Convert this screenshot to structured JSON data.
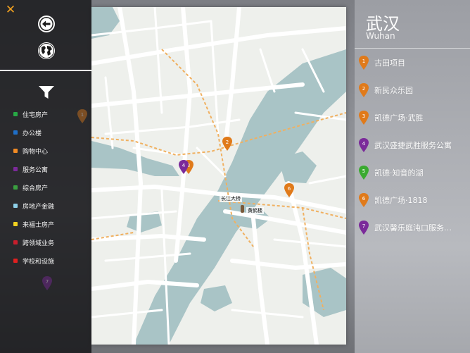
{
  "left_panel": {
    "categories": [
      {
        "label": "住宅房产",
        "color": "#27a845"
      },
      {
        "label": "办公楼",
        "color": "#1f6fc8"
      },
      {
        "label": "购物中心",
        "color": "#f08a24"
      },
      {
        "label": "服务公寓",
        "color": "#7b2a9a"
      },
      {
        "label": "综合房产",
        "color": "#3aa040"
      },
      {
        "label": "房地产金融",
        "color": "#8ed0e8"
      },
      {
        "label": "来福士房产",
        "color": "#f0d020"
      },
      {
        "label": "跨领域业务",
        "color": "#c81e2c"
      },
      {
        "label": "学校和设施",
        "color": "#e02020"
      }
    ]
  },
  "map": {
    "labels": {
      "bridge": "长江大桥",
      "tower": "黄鹤楼"
    }
  },
  "right_panel": {
    "city_cn": "武汉",
    "city_en": "Wuhan",
    "projects": [
      {
        "num": "1",
        "name": "古田项目",
        "color": "#e07a1a"
      },
      {
        "num": "2",
        "name": "新民众乐园",
        "color": "#e07a1a"
      },
      {
        "num": "3",
        "name": "凯德广场·武胜",
        "color": "#e07a1a"
      },
      {
        "num": "4",
        "name": "武汉盛捷武胜服务公寓",
        "color": "#7b2a9a"
      },
      {
        "num": "5",
        "name": "凯德·知音的湖",
        "color": "#3aaa30"
      },
      {
        "num": "6",
        "name": "凯德广场·1818",
        "color": "#e07a1a"
      },
      {
        "num": "7",
        "name": "武汉馨乐庭沌口服务…",
        "color": "#7b2a9a"
      }
    ]
  },
  "colors": {
    "accent": "#f0a020",
    "water": "#a9c4c6",
    "road": "#ffffff",
    "land": "#eef0ec"
  }
}
